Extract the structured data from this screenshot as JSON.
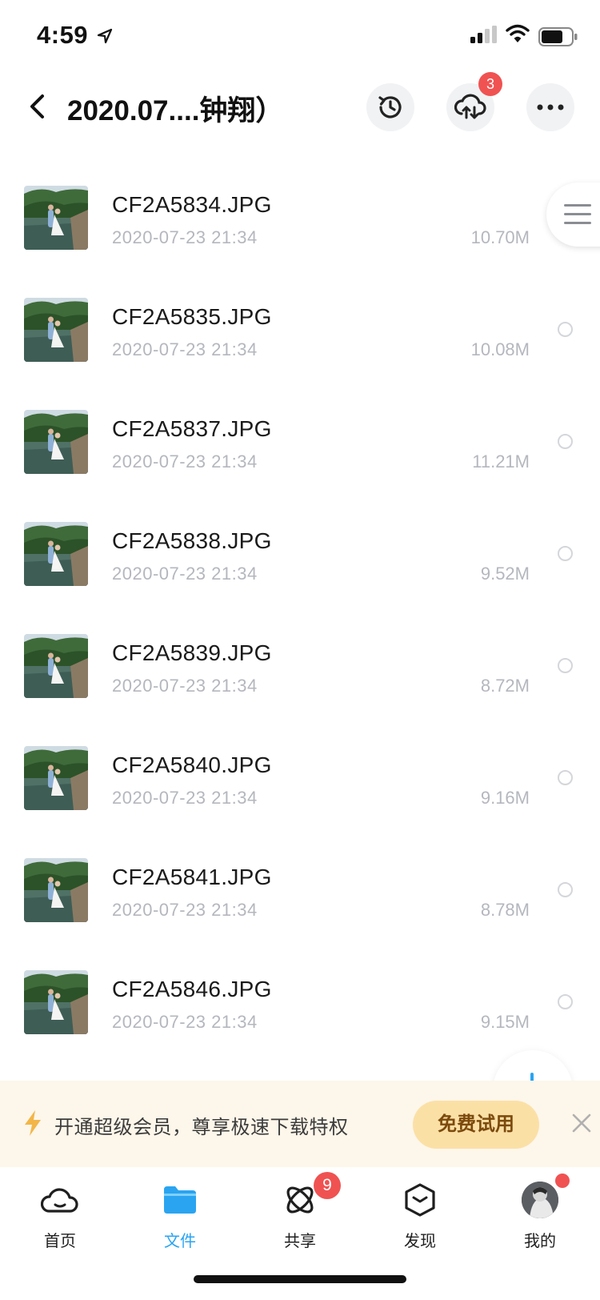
{
  "status_bar": {
    "time": "4:59"
  },
  "header": {
    "title": "2020.07....钟翔）",
    "transfer_badge": "3"
  },
  "files": [
    {
      "name": "CF2A5834.JPG",
      "date": "2020-07-23 21:34",
      "size": "10.70M"
    },
    {
      "name": "CF2A5835.JPG",
      "date": "2020-07-23 21:34",
      "size": "10.08M"
    },
    {
      "name": "CF2A5837.JPG",
      "date": "2020-07-23 21:34",
      "size": "11.21M"
    },
    {
      "name": "CF2A5838.JPG",
      "date": "2020-07-23 21:34",
      "size": "9.52M"
    },
    {
      "name": "CF2A5839.JPG",
      "date": "2020-07-23 21:34",
      "size": "8.72M"
    },
    {
      "name": "CF2A5840.JPG",
      "date": "2020-07-23 21:34",
      "size": "9.16M"
    },
    {
      "name": "CF2A5841.JPG",
      "date": "2020-07-23 21:34",
      "size": "8.78M"
    },
    {
      "name": "CF2A5846.JPG",
      "date": "2020-07-23 21:34",
      "size": "9.15M"
    }
  ],
  "promo": {
    "text": "开通超级会员，尊享极速下载特权",
    "button": "免费试用"
  },
  "tabs": {
    "home": "首页",
    "files": "文件",
    "share": "共享",
    "share_badge": "9",
    "discover": "发现",
    "me": "我的"
  },
  "colors": {
    "accent": "#2aa4f1",
    "badge": "#f05252",
    "promo_bg": "#fdf6ea",
    "promo_button": "#fbe0a6"
  }
}
